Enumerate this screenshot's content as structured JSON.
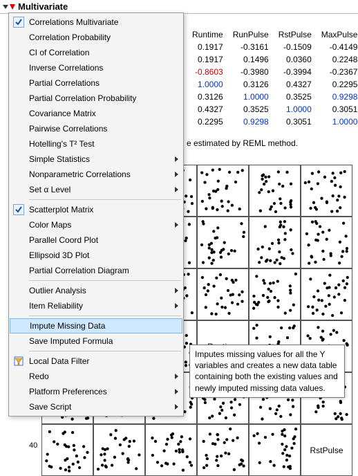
{
  "header": {
    "title": "Multivariate"
  },
  "menu": {
    "items": [
      {
        "label": "Correlations Multivariate",
        "checked": true
      },
      {
        "label": "Correlation Probability"
      },
      {
        "label": "CI of Correlation"
      },
      {
        "label": "Inverse Correlations"
      },
      {
        "label": "Partial Correlations"
      },
      {
        "label": "Partial Correlation Probability"
      },
      {
        "label": "Covariance Matrix"
      },
      {
        "label": "Pairwise Correlations"
      },
      {
        "label": "Hotelling's T² Test"
      },
      {
        "label": "Simple Statistics",
        "submenu": true
      },
      {
        "label": "Nonparametric Correlations",
        "submenu": true
      },
      {
        "label": "Set α Level",
        "submenu": true
      },
      {
        "sep": true
      },
      {
        "label": "Scatterplot Matrix",
        "checked": true
      },
      {
        "label": "Color Maps",
        "submenu": true
      },
      {
        "label": "Parallel Coord Plot"
      },
      {
        "label": "Ellipsoid 3D Plot"
      },
      {
        "label": "Partial Correlation Diagram"
      },
      {
        "sep": true
      },
      {
        "label": "Outlier Analysis",
        "submenu": true
      },
      {
        "label": "Item Reliability",
        "submenu": true
      },
      {
        "sep": true
      },
      {
        "label": "Impute Missing Data",
        "highlight": true
      },
      {
        "label": "Save Imputed Formula"
      },
      {
        "sep": true
      },
      {
        "label": "Local Data Filter",
        "icon": "filter"
      },
      {
        "label": "Redo",
        "submenu": true
      },
      {
        "label": "Platform Preferences",
        "submenu": true
      },
      {
        "label": "Save Script",
        "submenu": true
      }
    ]
  },
  "table": {
    "headers": [
      "Runtime",
      "RunPulse",
      "RstPulse",
      "MaxPulse"
    ],
    "rows": [
      {
        "cells": [
          "0.1917",
          "-0.3161",
          "-0.1509",
          "-0.4149"
        ],
        "styles": [
          "",
          "",
          "",
          ""
        ]
      },
      {
        "cells": [
          "0.1917",
          "0.1496",
          "0.0360",
          "0.2248"
        ],
        "styles": [
          "",
          "",
          "",
          ""
        ]
      },
      {
        "cells": [
          "-0.8603",
          "-0.3980",
          "-0.3994",
          "-0.2367"
        ],
        "styles": [
          "red",
          "",
          "",
          ""
        ]
      },
      {
        "cells": [
          "1.0000",
          "0.3126",
          "0.4327",
          "0.2295"
        ],
        "styles": [
          "blue",
          "",
          "",
          ""
        ]
      },
      {
        "cells": [
          "0.3126",
          "1.0000",
          "0.3525",
          "0.9298"
        ],
        "styles": [
          "",
          "blue",
          "",
          "blue"
        ]
      },
      {
        "cells": [
          "0.4327",
          "0.3525",
          "1.0000",
          "0.3051"
        ],
        "styles": [
          "",
          "",
          "blue",
          ""
        ]
      },
      {
        "cells": [
          "0.2295",
          "0.9298",
          "0.3051",
          "1.0000"
        ],
        "styles": [
          "",
          "blue",
          "",
          "blue"
        ]
      }
    ]
  },
  "reml_note": "e estimated by REML method.",
  "scatter_labels": {
    "runtime": "Runtime",
    "rstpulse": "RstPulse"
  },
  "tooltip": "Imputes missing values for all the Y variables and creates a new data table containing both the existing values and newly imputed missing data values.",
  "axis_tick": "40"
}
